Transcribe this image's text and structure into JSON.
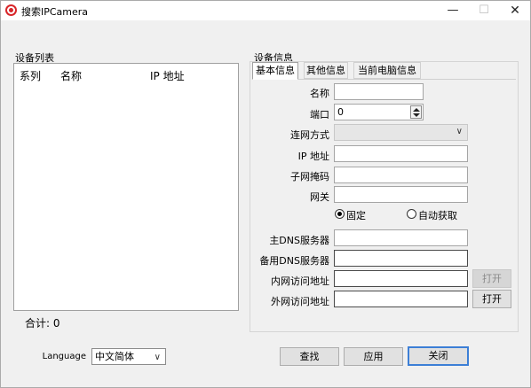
{
  "window": {
    "title": "搜索IPCamera",
    "min_glyph": "—",
    "max_glyph": "☐",
    "close_glyph": "✕"
  },
  "device_list": {
    "group_label": "设备列表",
    "columns": [
      "系列",
      "名称",
      "IP 地址"
    ],
    "rows": [],
    "total_label": "合计: 0"
  },
  "device_info": {
    "group_label": "设备信息",
    "tabs": [
      {
        "label": "基本信息",
        "active": true
      },
      {
        "label": "其他信息",
        "active": false
      },
      {
        "label": "当前电脑信息",
        "active": false
      }
    ],
    "fields": {
      "name_label": "名称",
      "name_value": "",
      "port_label": "端口",
      "port_value": "0",
      "network_mode_label": "连网方式",
      "network_mode_value": "",
      "ip_label": "IP 地址",
      "ip_value": "",
      "subnet_label": "子网掩码",
      "subnet_value": "",
      "gateway_label": "网关",
      "gateway_value": "",
      "radio_fixed": "固定",
      "radio_auto": "自动获取",
      "dns_primary_label": "主DNS服务器",
      "dns_primary_value": "",
      "dns_backup_label": "备用DNS服务器",
      "dns_backup_value": "",
      "lan_addr_label": "内网访问地址",
      "lan_addr_value": "",
      "wan_addr_label": "外网访问地址",
      "wan_addr_value": "",
      "open_label": "打开"
    }
  },
  "footer": {
    "language_label": "Language",
    "language_value": "中文简体",
    "search_button": "查找",
    "apply_button": "应用",
    "close_button": "关闭"
  },
  "colors": {
    "accent": "#3c7fd6",
    "icon_red": "#d8262a"
  }
}
